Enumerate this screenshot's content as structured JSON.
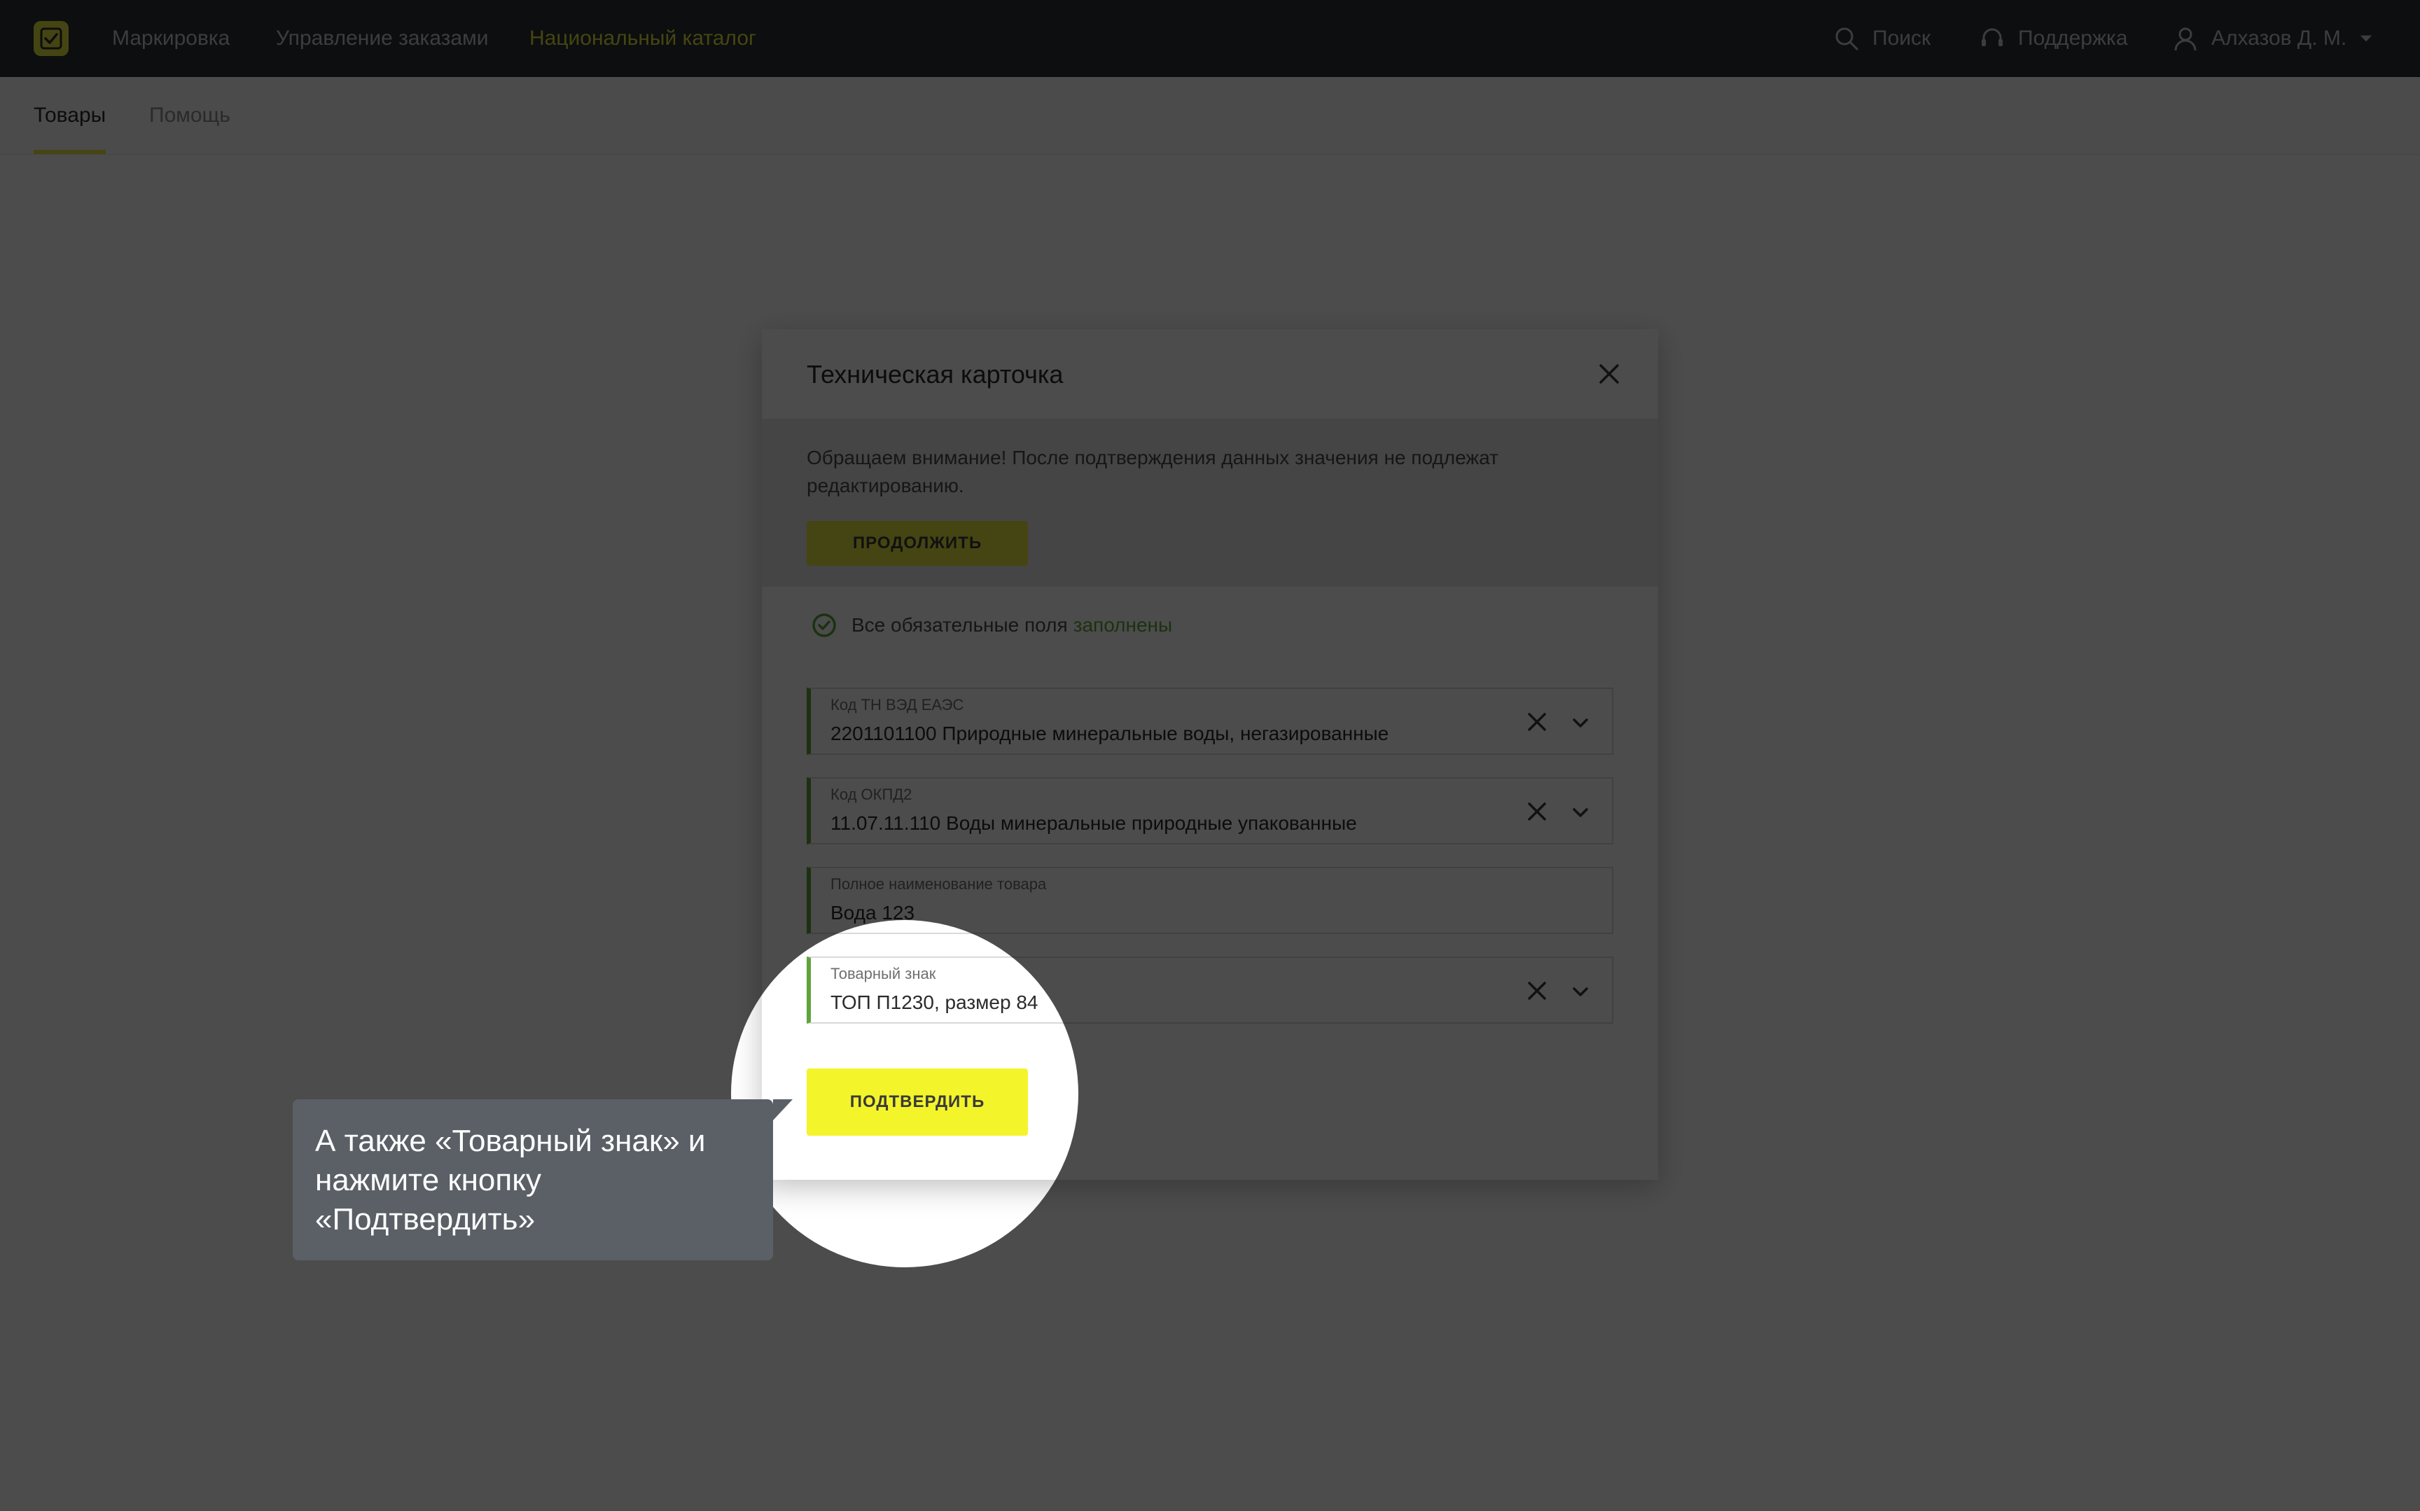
{
  "nav": {
    "items": [
      "Маркировка",
      "Управление заказами",
      "Национальный каталог"
    ],
    "search_label": "Поиск",
    "support_label": "Поддержка",
    "user_label": "Алхазов Д. М."
  },
  "subtabs": [
    "Товары",
    "Помощь"
  ],
  "modal": {
    "title": "Техническая карточка",
    "warning": "Обращаем внимание! После подтверждения данных значения не подлежат редактированию.",
    "continue_label": "ПРОДОЛЖИТЬ",
    "status_text": "Все обязательные поля",
    "status_ok": "заполнены",
    "fields": [
      {
        "label": "Код ТН ВЭД ЕАЭС",
        "value": "2201101100 Природные минеральные воды, негазированные"
      },
      {
        "label": "Код ОКПД2",
        "value": "11.07.11.110 Воды минеральные природные упакованные"
      },
      {
        "label": "Полное наименование товара",
        "value": "Вода 123"
      },
      {
        "label": "Товарный знак",
        "value": "ТОП П1230, размер 84"
      }
    ],
    "confirm_label": "ПОДТВЕРДИТЬ"
  },
  "tooltip": {
    "text": "А также «Товарный знак» и нажмите кнопку «Подтвердить»"
  },
  "colors": {
    "brand_yellow": "#e6e640",
    "success_green": "#5fa53b",
    "topbar": "#2b2f33"
  }
}
